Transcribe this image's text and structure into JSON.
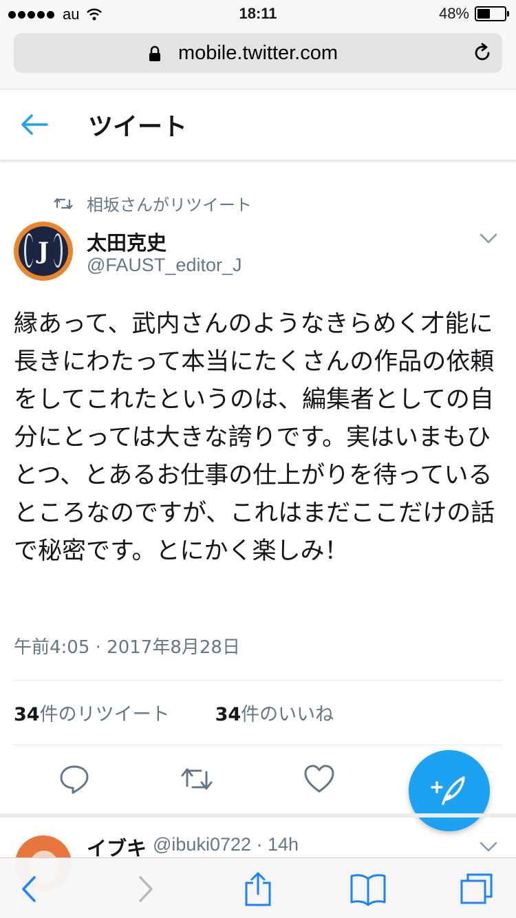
{
  "status_bar": {
    "carrier": "au",
    "time": "18:11",
    "battery_percent": "48%",
    "battery_level": 0.48
  },
  "browser": {
    "url": "mobile.twitter.com"
  },
  "header": {
    "title": "ツイート"
  },
  "tweet": {
    "retweeted_by": "相坂さんがリツイート",
    "author_name": "太田克史",
    "author_handle": "@FAUST_editor_J",
    "avatar_letter": "J",
    "text": "縁あって、武内さんのようなきらめく才能に長きにわたって本当にたくさんの作品の依頼をしてこれたというのは、編集者としての自分にとっては大きな誇りです。実はいまもひとつ、とあるお仕事の仕上がりを待っているところなのですが、これはまだここだけの話で秘密です。とにかく楽しみ！",
    "timestamp": "午前4:05 · 2017年8月28日",
    "retweet_count": "34",
    "retweet_label": "件のリツイート",
    "like_count": "34",
    "like_label": "件のいいね"
  },
  "reply": {
    "name": "イブキ",
    "handle_time": "@ibuki0722 · 14h"
  },
  "colors": {
    "accent": "#1da1f2",
    "text": "#14171a",
    "muted": "#657786",
    "ios_blue": "#1a82fb"
  },
  "icons": {
    "back": "arrow-left-icon",
    "retweet_indicator": "retweet-icon",
    "caret": "chevron-down-icon",
    "reply": "speech-bubble-icon",
    "retweet": "retweet-icon",
    "like": "heart-icon",
    "compose": "feather-plus-icon",
    "toolbar": [
      "chevron-left-icon",
      "chevron-right-icon",
      "share-icon",
      "book-icon",
      "tabs-icon"
    ]
  }
}
